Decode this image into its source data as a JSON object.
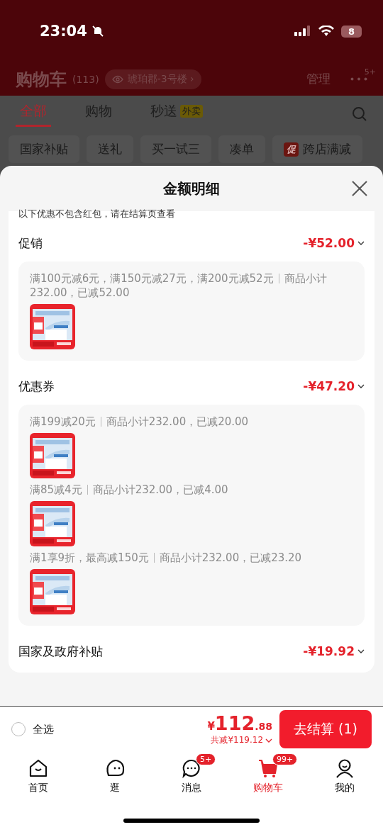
{
  "status_bar": {
    "time": "23:04",
    "battery": "8"
  },
  "header": {
    "title": "购物车",
    "count": "(113)",
    "address": "琥珀郡-3号楼",
    "chevron": "›",
    "manage": "管理",
    "more_badge": "5+"
  },
  "tabs": [
    {
      "label": "全部",
      "selected": true
    },
    {
      "label": "购物",
      "selected": false
    },
    {
      "label": "秒送",
      "tag": "外卖",
      "selected": false
    }
  ],
  "chips": [
    {
      "label": "国家补贴"
    },
    {
      "label": "送礼"
    },
    {
      "label": "买一试三"
    },
    {
      "label": "凑单"
    },
    {
      "label": "跨店满减",
      "tag": "促"
    }
  ],
  "sheet": {
    "title": "金额明细",
    "notice": "以下优惠不包含红包，请在结算页查看",
    "sections": [
      {
        "name": "促销",
        "amount": "-¥52.00",
        "items": [
          {
            "rule": "满100元减6元，满150元减27元，满200元减52元",
            "detail": "商品小计232.00，已减52.00"
          }
        ]
      },
      {
        "name": "优惠券",
        "amount": "-¥47.20",
        "items": [
          {
            "rule": "满199减20元",
            "detail": "商品小计232.00，已减20.00"
          },
          {
            "rule": "满85减4元",
            "detail": "商品小计232.00，已减4.00"
          },
          {
            "rule": "满1享9折，最高减150元",
            "detail": "商品小计232.00，已减23.20"
          }
        ]
      },
      {
        "name": "国家及政府补贴",
        "amount": "-¥19.92"
      }
    ]
  },
  "checkout_bar": {
    "select_all": {
      "label": "全选",
      "checked": false
    },
    "currency": "¥",
    "integer": "112",
    "decimal": ".88",
    "saved": "共减¥119.12",
    "button": "去结算 (1)"
  },
  "nav": [
    {
      "kind": "home",
      "label": "首页",
      "selected": false
    },
    {
      "kind": "browse",
      "label": "逛",
      "selected": false
    },
    {
      "kind": "message",
      "label": "消息",
      "badge": "5+",
      "selected": false
    },
    {
      "kind": "cart",
      "label": "购物车",
      "badge": "99+",
      "selected": true
    },
    {
      "kind": "profile",
      "label": "我的",
      "selected": false
    }
  ]
}
